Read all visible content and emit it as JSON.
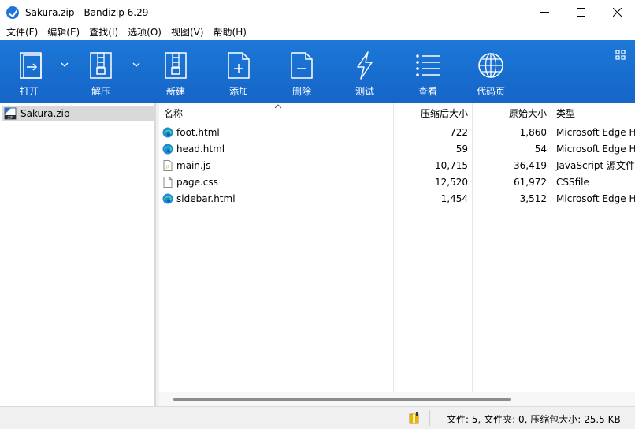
{
  "window": {
    "title": "Sakura.zip - Bandizip 6.29"
  },
  "menu": [
    {
      "label": "文件(F)"
    },
    {
      "label": "编辑(E)"
    },
    {
      "label": "查找(I)"
    },
    {
      "label": "选项(O)"
    },
    {
      "label": "视图(V)"
    },
    {
      "label": "帮助(H)"
    }
  ],
  "toolbar": {
    "open": "打开",
    "extract": "解压",
    "new": "新建",
    "add": "添加",
    "delete": "删除",
    "test": "测试",
    "view": "查看",
    "codepage": "代码页"
  },
  "tree": {
    "root": "Sakura.zip"
  },
  "columns": {
    "name": "名称",
    "compressed": "压缩后大小",
    "original": "原始大小",
    "type": "类型"
  },
  "files": [
    {
      "name": "foot.html",
      "compressed": "722",
      "original": "1,860",
      "type": "Microsoft Edge HTML Document",
      "icon": "edge-icon"
    },
    {
      "name": "head.html",
      "compressed": "59",
      "original": "54",
      "type": "Microsoft Edge HTML Document",
      "icon": "edge-icon"
    },
    {
      "name": "main.js",
      "compressed": "10,715",
      "original": "36,419",
      "type": "JavaScript 源文件",
      "icon": "js-file-icon"
    },
    {
      "name": "page.css",
      "compressed": "12,520",
      "original": "61,972",
      "type": "CSSfile",
      "icon": "css-file-icon"
    },
    {
      "name": "sidebar.html",
      "compressed": "1,454",
      "original": "3,512",
      "type": "Microsoft Edge HTML Document",
      "icon": "edge-icon"
    }
  ],
  "status": {
    "text": "文件: 5, 文件夹: 0, 压缩包大小: 25.5 KB"
  },
  "colors": {
    "toolbar": "#1c78d8",
    "accent": "#1e74d9"
  }
}
